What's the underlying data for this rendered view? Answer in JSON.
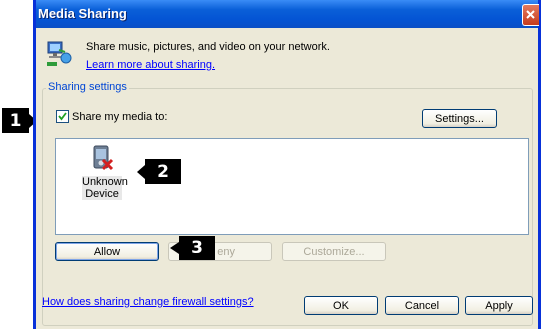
{
  "window": {
    "title": "Media Sharing"
  },
  "intro": {
    "text": "Share music, pictures, and video on your network.",
    "learn_more": "Learn more about sharing."
  },
  "sharing": {
    "group_label": "Sharing settings",
    "checkbox_label": "Share my media to:",
    "checked": true,
    "settings_button": "Settings...",
    "devices": [
      {
        "label_line1": "Unknown",
        "label_line2": "Device"
      }
    ],
    "allow_button": "Allow",
    "deny_button": "Deny",
    "deny_visible_text": "eny",
    "customize_button": "Customize..."
  },
  "footer": {
    "firewall_link": "How does sharing change firewall settings?",
    "ok_button": "OK",
    "cancel_button": "Cancel",
    "apply_button": "Apply"
  },
  "callouts": [
    "1",
    "2",
    "3"
  ],
  "colors": {
    "title_bar": "#0a5fd8",
    "link": "#0000ff",
    "callout_bg": "#000000",
    "window_bg": "#ece9d8"
  }
}
